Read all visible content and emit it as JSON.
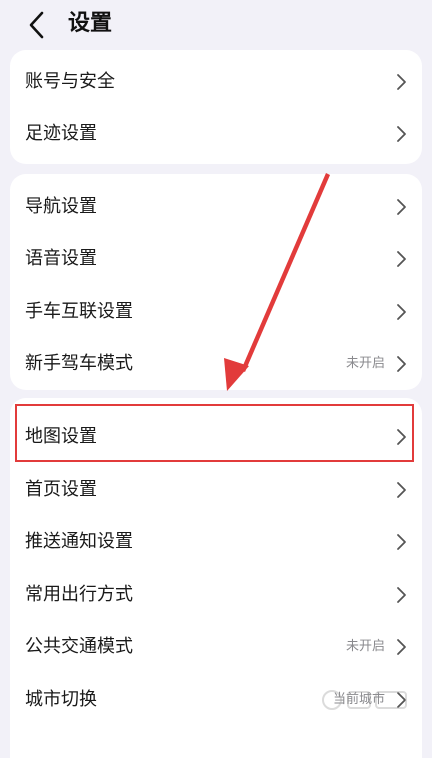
{
  "header": {
    "title": "设置",
    "back_icon": "chevron-left-icon"
  },
  "group1": {
    "items": [
      {
        "label": "账号与安全"
      },
      {
        "label": "足迹设置"
      }
    ]
  },
  "group2": {
    "items": [
      {
        "label": "导航设置"
      },
      {
        "label": "语音设置"
      },
      {
        "label": "手车互联设置"
      },
      {
        "label": "新手驾车模式",
        "value": "未开启"
      }
    ]
  },
  "group3": {
    "items": [
      {
        "label": "地图设置"
      },
      {
        "label": "首页设置"
      },
      {
        "label": "推送通知设置"
      },
      {
        "label": "常用出行方式"
      },
      {
        "label": "公共交通模式",
        "value": "未开启"
      },
      {
        "label": "城市切换",
        "value": "当前城市"
      }
    ]
  },
  "annotation": {
    "highlight_color": "#e23b3b",
    "arrow_color": "#e23b3b"
  },
  "colors": {
    "background": "#f2f1f8",
    "card": "#ffffff",
    "value_text": "#8a8a8e"
  }
}
